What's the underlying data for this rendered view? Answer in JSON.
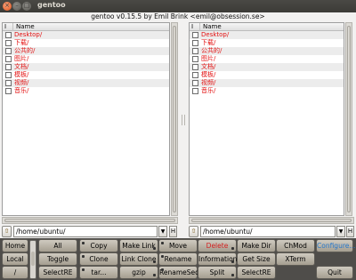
{
  "window": {
    "title": "gentoo",
    "subtitle": "gentoo v0.15.5 by Emil Brink <emil@obsession.se>",
    "controls": [
      "close-icon",
      "minimize-icon",
      "maximize-icon"
    ]
  },
  "left_pane": {
    "col_index": "I",
    "col_name": "Name",
    "files": [
      "Desktop/",
      "下载/",
      "公共的/",
      "图片/",
      "文档/",
      "模板/",
      "视频/",
      "音乐/"
    ],
    "path": "/home/ubuntu/",
    "history_label": "H",
    "dropdown_glyph": "▼"
  },
  "right_pane": {
    "col_index": "I",
    "col_name": "Name",
    "files": [
      "Desktop/",
      "下载/",
      "公共的/",
      "图片/",
      "文档/",
      "模板/",
      "视频/",
      "音乐/"
    ],
    "path": "/home/ubuntu/",
    "history_label": "H",
    "dropdown_glyph": "▼"
  },
  "side_buttons": [
    "Home",
    "Local",
    "/"
  ],
  "buttons": [
    [
      "All",
      "Copy",
      "Make Link",
      "Move",
      "Delete",
      "Make Dir",
      "ChMod",
      "Configure..."
    ],
    [
      "Toggle",
      "Clone",
      "Link Clone",
      "Rename",
      "Information",
      "Get Size",
      "XTerm"
    ],
    [
      "SelectRE",
      "tar...",
      "gzip",
      "RenameSeq",
      "Split",
      "SelectRE",
      "Quit"
    ]
  ],
  "colors": {
    "file_name": "#e31010",
    "delete_label": "#d42222",
    "configure_label": "#2777c9",
    "button_bg": "#bdb6a8"
  }
}
